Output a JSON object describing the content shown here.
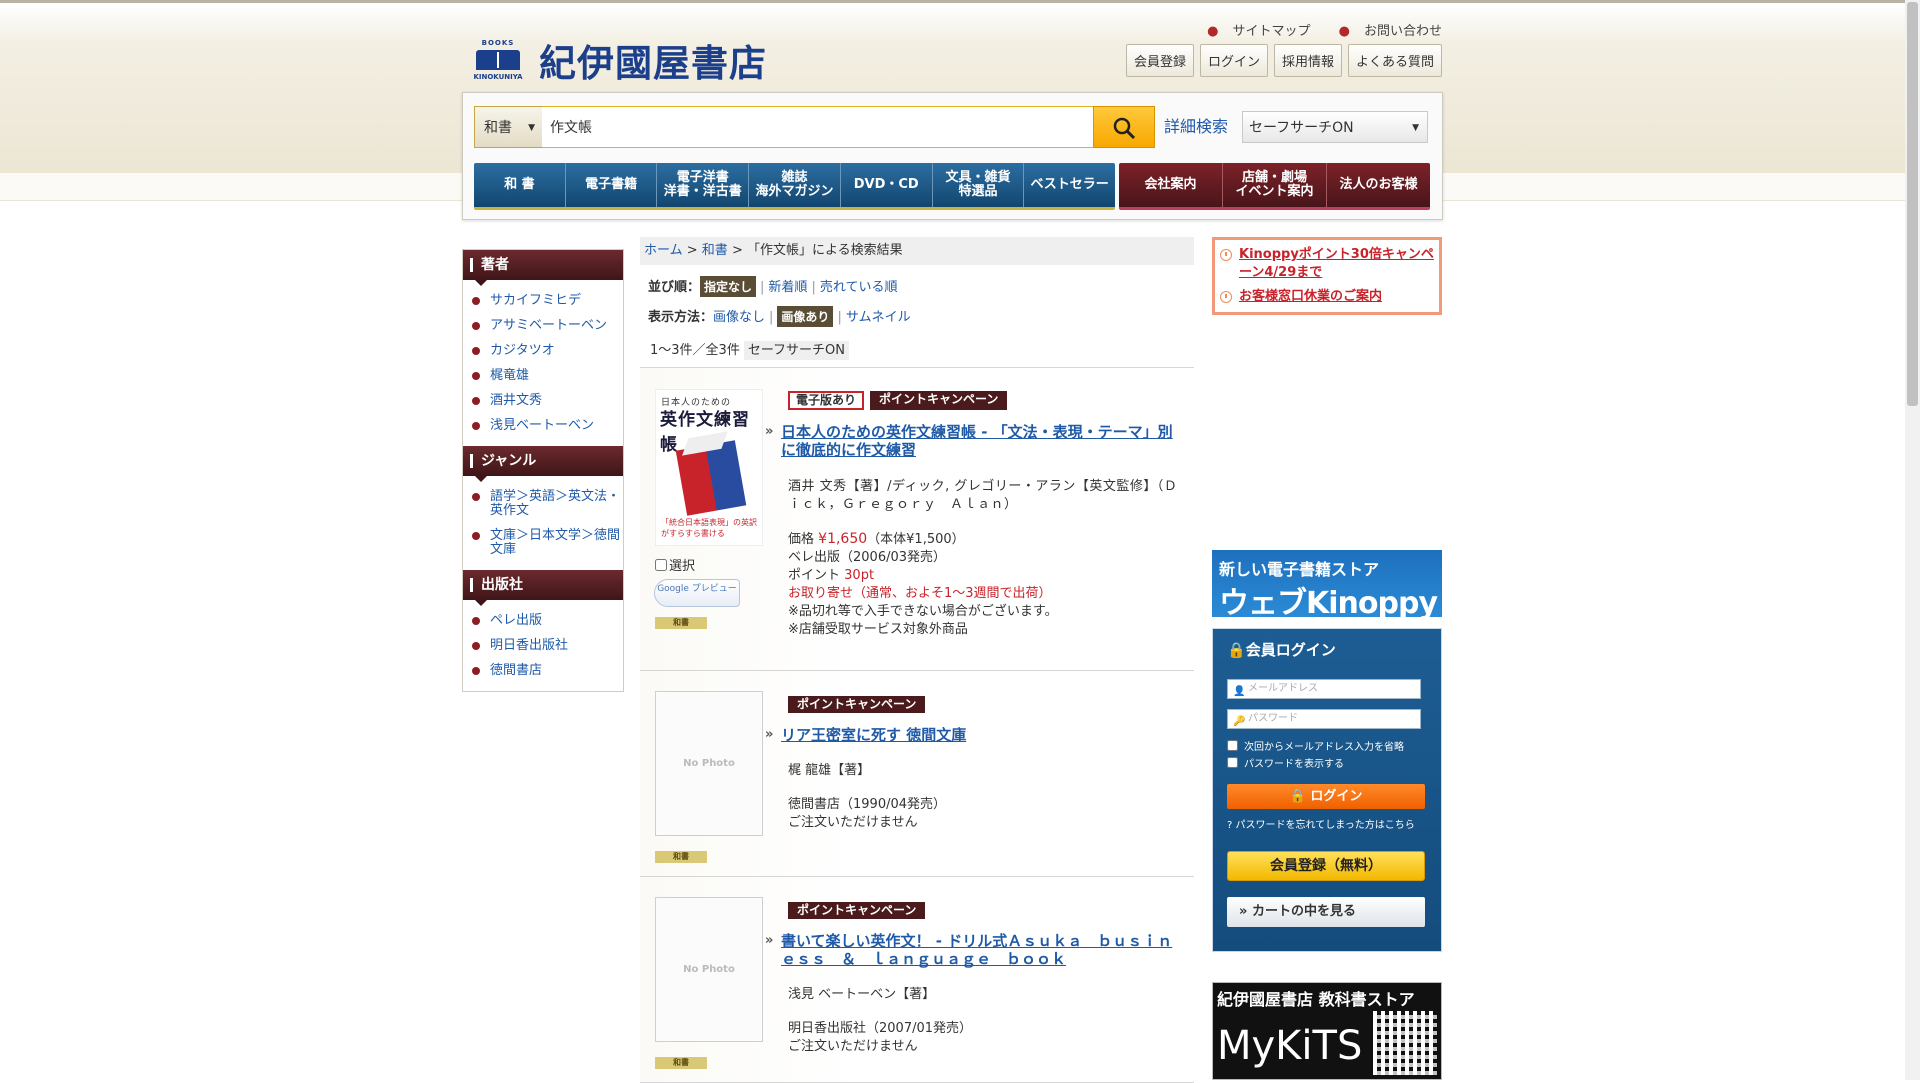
{
  "header": {
    "logo_top": "BOOKS",
    "logo_bottom": "KINOKUNIYA",
    "site_name": "紀伊國屋書店",
    "top_links": [
      "サイトマップ",
      "お問い合わせ"
    ],
    "buttons": [
      "会員登録",
      "ログイン",
      "採用情報",
      "よくある質問"
    ]
  },
  "search": {
    "category": "和書",
    "query": "作文帳",
    "advanced_label": "詳細検索",
    "safe_search": "セーフサーチON"
  },
  "nav_main": [
    {
      "label": "和 書"
    },
    {
      "label": "電子書籍"
    },
    {
      "label": "電子洋書\n洋書・洋古書"
    },
    {
      "label": "雑誌\n海外マガジン"
    },
    {
      "label": "DVD・CD"
    },
    {
      "label": "文具・雑貨\n特選品"
    },
    {
      "label": "ベストセラー"
    }
  ],
  "nav_sub": [
    {
      "label": "会社案内"
    },
    {
      "label": "店舗・劇場\nイベント案内"
    },
    {
      "label": "法人のお客様"
    }
  ],
  "sidebar": {
    "sections": [
      {
        "title": "著者",
        "items": [
          "サカイフミヒデ",
          "アサミベートーベン",
          "カジタツオ",
          "梶竜雄",
          "酒井文秀",
          "浅見ベートーベン"
        ]
      },
      {
        "title": "ジャンル",
        "items": [
          "語学＞英語＞英文法・英作文",
          "文庫＞日本文学＞徳間文庫"
        ]
      },
      {
        "title": "出版社",
        "items": [
          "ペレ出版",
          "明日香出版社",
          "徳間書店"
        ]
      }
    ]
  },
  "breadcrumb": {
    "home": "ホーム",
    "sep": " > ",
    "cat": "和書",
    "current": "「作文帳」による検索結果"
  },
  "sort": {
    "label": "並び順：",
    "active": "指定なし",
    "options": [
      "新着順",
      "売れている順"
    ]
  },
  "view": {
    "label": "表示方法：",
    "opt1": "画像なし",
    "active": "画像あり",
    "opt3": "サムネイル"
  },
  "count": {
    "text": "1～3件／全3件",
    "safe": "セーフサーチON"
  },
  "items": [
    {
      "badge_digital": "電子版あり",
      "badge_point": "ポイントキャンペーン",
      "title": "日本人のための英作文練習帳 - 「文法・表現・テーマ」別に徹底的に作文練習",
      "authors": "酒井 文秀【著】/ディック, グレゴリー・アラン【英文監修】（Ｄｉｃｋ，Ｇｒｅｇｏｒｙ　Ａｌａｎ）",
      "price_label": "価格",
      "price": "¥1,650",
      "price_note": "（本体¥1,500）",
      "publisher": "ベレ出版（2006/03発売）",
      "point_label": "ポイント",
      "point": "30pt",
      "availability": "お取り寄せ（通常、およそ1～3週間で出荷）",
      "note1": "※品切れ等で入手できない場合がございます。",
      "note2": "※店舗受取サービス対象外商品",
      "select_label": "選択",
      "preview_label": "Google プレビュー",
      "genre": "和書",
      "cover_top": "日本人のための",
      "cover_title": "英作文練習帳",
      "cover_bottom": "「統合日本語表現」の英訳がすらすら書ける"
    },
    {
      "badge_point": "ポイントキャンペーン",
      "title": "リア王密室に死す 徳間文庫",
      "authors": "梶 龍雄【著】",
      "publisher": "徳間書店（1990/04発売）",
      "availability": "ご注文いただけません",
      "no_photo": "No Photo",
      "genre": "和書"
    },
    {
      "badge_point": "ポイントキャンペーン",
      "title": "書いて楽しい英作文！ - ドリル式Ａｓｕｋａ　ｂｕｓｉｎｅｓｓ　＆　ｌａｎｇｕａｇｅ　ｂｏｏｋ",
      "authors": "浅見 ベートーベン【著】",
      "publisher": "明日香出版社（2007/01発売）",
      "availability": "ご注文いただけません",
      "no_photo": "No Photo",
      "genre": "和書"
    }
  ],
  "right": {
    "notices": [
      "Kinoppyポイント30倍キャンペーン4/29まで",
      "お客様窓口休業のご案内"
    ],
    "kinoppy_line1": "新しい電子書籍ストア",
    "kinoppy_line2": "ウェブKinoppy",
    "login": {
      "title": "会員ログイン",
      "email_placeholder": "メールアドレス",
      "password_placeholder": "パスワード",
      "remember": "次回からメールアドレス入力を省略",
      "show_password": "パスワードを表示する",
      "login_button": "ログイン",
      "forgot": "パスワードを忘れてしまった方はこちら",
      "register": "会員登録（無料）",
      "cart": "カートの中を見る"
    },
    "mykits_line1": "紀伊國屋書店 教科書ストア",
    "mykits_line2": "MyKiTS"
  }
}
